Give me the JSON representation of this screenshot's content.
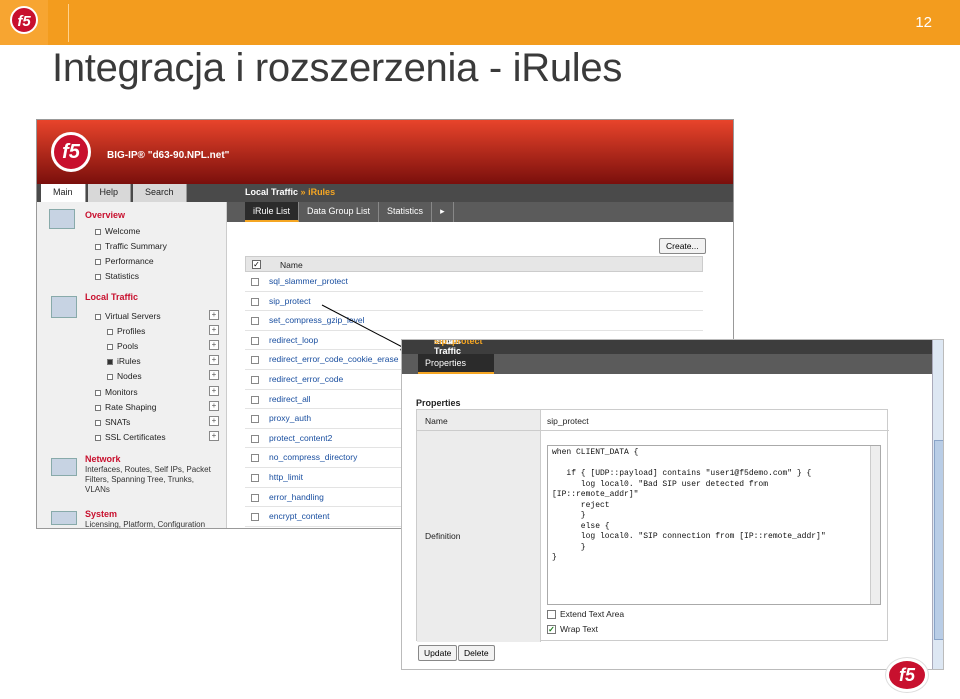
{
  "slide": {
    "title": "Integracja i rozszerzenia - iRules",
    "number": "12",
    "logo_text": "f5",
    "accent_color": "#f39c1e",
    "brand_color": "#c8102e"
  },
  "app": {
    "logo_text": "f5",
    "host": "BIG-IP® \"d63-90.NPL.net\"",
    "top_tabs": [
      "Main",
      "Help",
      "Search"
    ],
    "breadcrumb": {
      "section": "Local Traffic",
      "sep": "»",
      "page": "iRules"
    },
    "sub_tabs": [
      "iRule List",
      "Data Group List",
      "Statistics"
    ],
    "sub_tabs_more": "▸",
    "sidebar": {
      "overview": {
        "title": "Overview",
        "items": [
          "Welcome",
          "Traffic Summary",
          "Performance",
          "Statistics"
        ]
      },
      "local_traffic": {
        "title": "Local Traffic",
        "items": [
          "Virtual Servers",
          "Profiles",
          "Pools",
          "iRules",
          "Nodes",
          "Monitors",
          "Rate Shaping",
          "SNATs",
          "SSL Certificates"
        ]
      },
      "network": {
        "title": "Network",
        "desc": [
          "Interfaces, Routes, Self IPs, Packet",
          "Filters, Spanning Tree, Trunks,",
          "VLANs"
        ]
      },
      "system": {
        "title": "System",
        "desc": [
          "Licensing, Platform, Configuration"
        ]
      }
    },
    "create_button": "Create...",
    "list": {
      "column": "Name",
      "rows": [
        "sql_slammer_protect",
        "sip_protect",
        "set_compress_gzip_level",
        "redirect_loop",
        "redirect_error_code_cookie_erase",
        "redirect_error_code",
        "redirect_all",
        "proxy_auth",
        "protect_content2",
        "no_compress_directory",
        "http_limit",
        "error_handling",
        "encrypt_content"
      ]
    }
  },
  "popup": {
    "breadcrumb": {
      "section": "Local Traffic",
      "sep": "»",
      "page": "iRules",
      "sep2": "»",
      "item": "sip_protect"
    },
    "tab": "Properties",
    "section_title": "Properties",
    "name_label": "Name",
    "name_value": "sip_protect",
    "definition_label": "Definition",
    "code": "when CLIENT_DATA {\n\n   if { [UDP::payload] contains \"user1@f5demo.com\" } {\n      log local0. \"Bad SIP user detected from\n[IP::remote_addr]\"\n      reject\n      }\n      else {\n      log local0. \"SIP connection from [IP::remote_addr]\"\n      }\n}",
    "extend_label": "Extend Text Area",
    "wrap_label": "Wrap Text",
    "update_button": "Update",
    "delete_button": "Delete"
  }
}
